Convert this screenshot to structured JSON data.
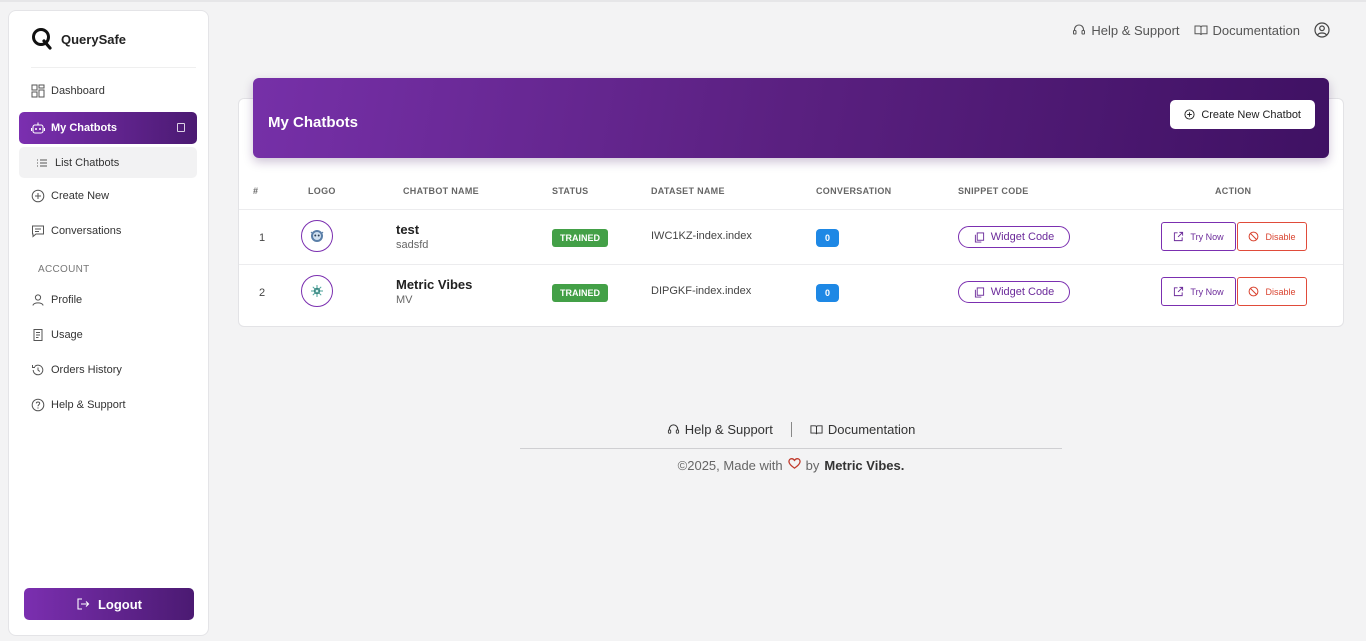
{
  "brand": {
    "name": "QuerySafe"
  },
  "sidebar": {
    "items": [
      {
        "label": "Dashboard",
        "icon": "grid-icon"
      },
      {
        "label": "My Chatbots",
        "icon": "robot-icon"
      },
      {
        "label": "List Chatbots",
        "icon": "list-icon"
      },
      {
        "label": "Create New",
        "icon": "plus-circle-icon"
      },
      {
        "label": "Conversations",
        "icon": "chat-icon"
      }
    ],
    "account_label": "ACCOUNT",
    "account_items": [
      {
        "label": "Profile",
        "icon": "user-icon"
      },
      {
        "label": "Usage",
        "icon": "receipt-icon"
      },
      {
        "label": "Orders History",
        "icon": "history-icon"
      },
      {
        "label": "Help & Support",
        "icon": "question-icon"
      }
    ],
    "logout_label": "Logout"
  },
  "topbar": {
    "help_label": "Help & Support",
    "docs_label": "Documentation"
  },
  "main": {
    "title": "My Chatbots",
    "create_label": "Create New Chatbot",
    "columns": [
      "#",
      "LOGO",
      "CHATBOT NAME",
      "STATUS",
      "DATASET NAME",
      "CONVERSATION",
      "SNIPPET CODE",
      "ACTION"
    ],
    "rows": [
      {
        "index": "1",
        "name": "test",
        "desc": "sadsfd",
        "status": "TRAINED",
        "dataset": "IWC1KZ-index.index",
        "conversations": "0",
        "widget_label": "Widget Code",
        "try_label": "Try Now",
        "disable_label": "Disable"
      },
      {
        "index": "2",
        "name": "Metric Vibes",
        "desc": "MV",
        "status": "TRAINED",
        "dataset": "DIPGKF-index.index",
        "conversations": "0",
        "widget_label": "Widget Code",
        "try_label": "Try Now",
        "disable_label": "Disable"
      }
    ]
  },
  "footer": {
    "help_label": "Help & Support",
    "docs_label": "Documentation",
    "copy_prefix": "©2025, Made with",
    "copy_by": "by",
    "copy_brand": "Metric Vibes."
  },
  "colors": {
    "accent": "#7b2fb0",
    "accent_dark": "#4b1a72",
    "trained": "#43a047",
    "count": "#1e88e5",
    "danger": "#e04b3a"
  }
}
